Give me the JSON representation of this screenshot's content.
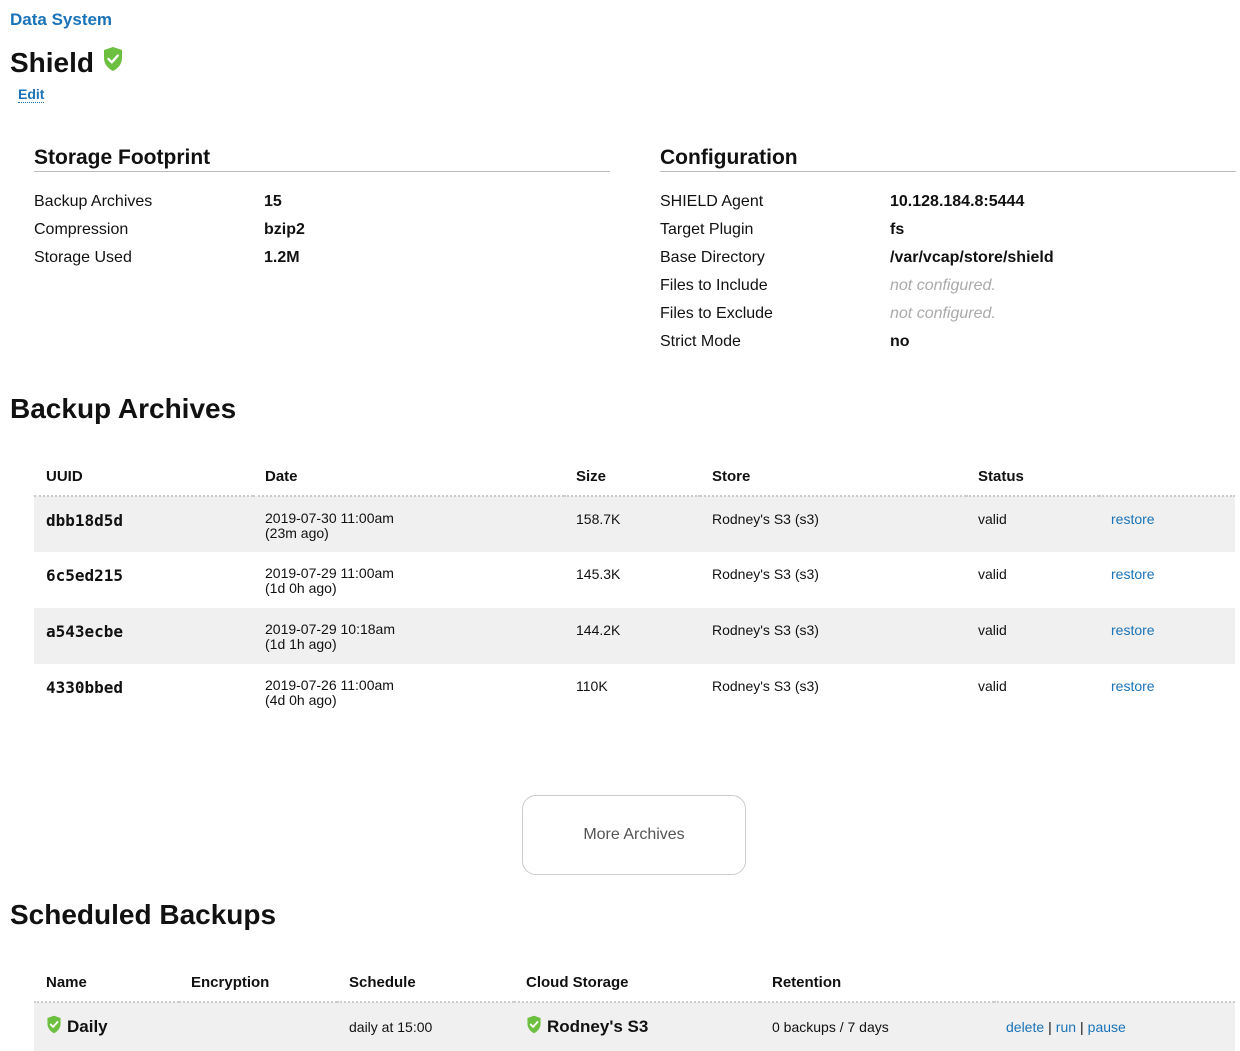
{
  "breadcrumb": "Data System",
  "title": "Shield",
  "edit_label": "Edit",
  "storage": {
    "heading": "Storage Footprint",
    "rows": [
      {
        "label": "Backup Archives",
        "value": "15"
      },
      {
        "label": "Compression",
        "value": "bzip2"
      },
      {
        "label": "Storage Used",
        "value": "1.2M"
      }
    ]
  },
  "config": {
    "heading": "Configuration",
    "rows": [
      {
        "label": "SHIELD Agent",
        "value": "10.128.184.8:5444"
      },
      {
        "label": "Target Plugin",
        "value": "fs"
      },
      {
        "label": "Base Directory",
        "value": "/var/vcap/store/shield"
      },
      {
        "label": "Files to Include",
        "value": "not configured."
      },
      {
        "label": "Files to Exclude",
        "value": "not configured."
      },
      {
        "label": "Strict Mode",
        "value": "no"
      }
    ]
  },
  "archives": {
    "heading": "Backup Archives",
    "columns": [
      "UUID",
      "Date",
      "Size",
      "Store",
      "Status"
    ],
    "rows": [
      {
        "uuid": "dbb18d5d",
        "date": "2019-07-30 11:00am",
        "ago": "(23m ago)",
        "size": "158.7K",
        "store": "Rodney's S3 (s3)",
        "status": "valid",
        "action": "restore"
      },
      {
        "uuid": "6c5ed215",
        "date": "2019-07-29 11:00am",
        "ago": "(1d 0h ago)",
        "size": "145.3K",
        "store": "Rodney's S3 (s3)",
        "status": "valid",
        "action": "restore"
      },
      {
        "uuid": "a543ecbe",
        "date": "2019-07-29 10:18am",
        "ago": "(1d 1h ago)",
        "size": "144.2K",
        "store": "Rodney's S3 (s3)",
        "status": "valid",
        "action": "restore"
      },
      {
        "uuid": "4330bbed",
        "date": "2019-07-26 11:00am",
        "ago": "(4d 0h ago)",
        "size": "110K",
        "store": "Rodney's S3 (s3)",
        "status": "valid",
        "action": "restore"
      }
    ],
    "more_label": "More Archives"
  },
  "scheduled": {
    "heading": "Scheduled Backups",
    "columns": [
      "Name",
      "Encryption",
      "Schedule",
      "Cloud Storage",
      "Retention"
    ],
    "rows": [
      {
        "name": "Daily",
        "encryption": "",
        "schedule": "daily at 15:00",
        "cloud": "Rodney's S3",
        "retention": "0 backups / 7 days",
        "actions": {
          "delete": "delete",
          "run": "run",
          "pause": "pause",
          "sep": "|"
        }
      }
    ]
  },
  "colors": {
    "link": "#1a73b8",
    "shield_green": "#6cbf3f",
    "row_alt": "#f0f0f0"
  }
}
